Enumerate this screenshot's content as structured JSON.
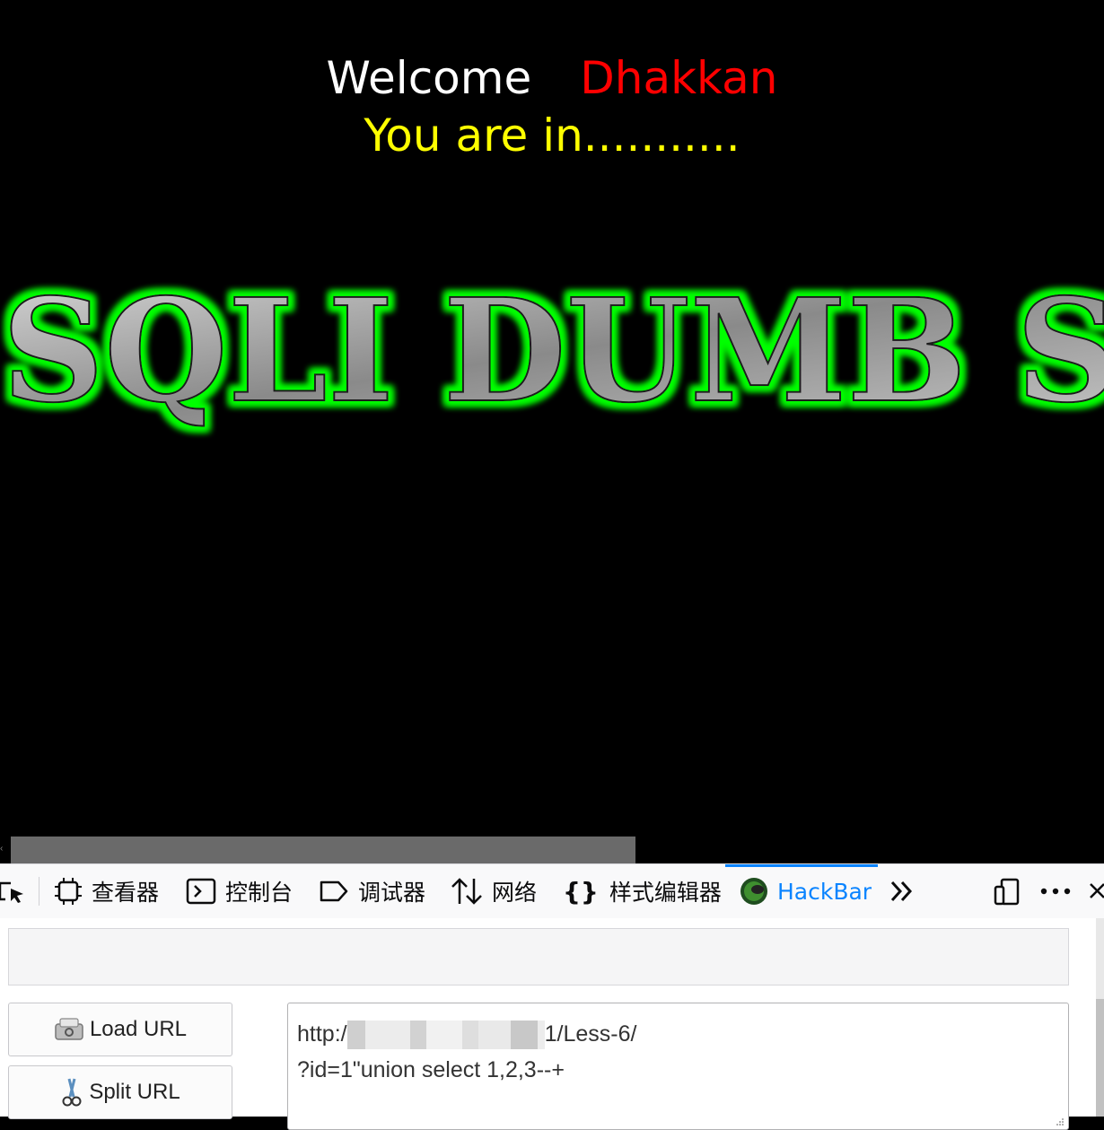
{
  "page": {
    "welcome_label": "Welcome",
    "user_name": "Dhakkan",
    "status_message": "You are in...........",
    "banner_text": "SQLI DUMB S"
  },
  "devtools": {
    "tabs": [
      {
        "label": "查看器",
        "icon": "inspector-icon"
      },
      {
        "label": "控制台",
        "icon": "console-icon"
      },
      {
        "label": "调试器",
        "icon": "debugger-icon"
      },
      {
        "label": "网络",
        "icon": "network-icon"
      },
      {
        "label": "样式编辑器",
        "icon": "style-editor-icon"
      },
      {
        "label": "HackBar",
        "icon": "hackbar-icon",
        "active": true
      }
    ],
    "overflow_icon": "double-chevron-icon",
    "responsive_icon": "responsive-design-icon",
    "menu_icon": "more-icon",
    "close_icon": "close-icon"
  },
  "hackbar": {
    "load_url_label": "Load URL",
    "split_url_label": "Split URL",
    "url_prefix": "http:/",
    "url_suffix": "1/Less-6/",
    "url_line2": "?id=1\"union select 1,2,3--+"
  },
  "colors": {
    "welcome": "#ffffff",
    "user_name": "#ff0000",
    "status": "#ffff00",
    "banner_glow": "#00ff00",
    "active_tab": "#0a84ff"
  }
}
